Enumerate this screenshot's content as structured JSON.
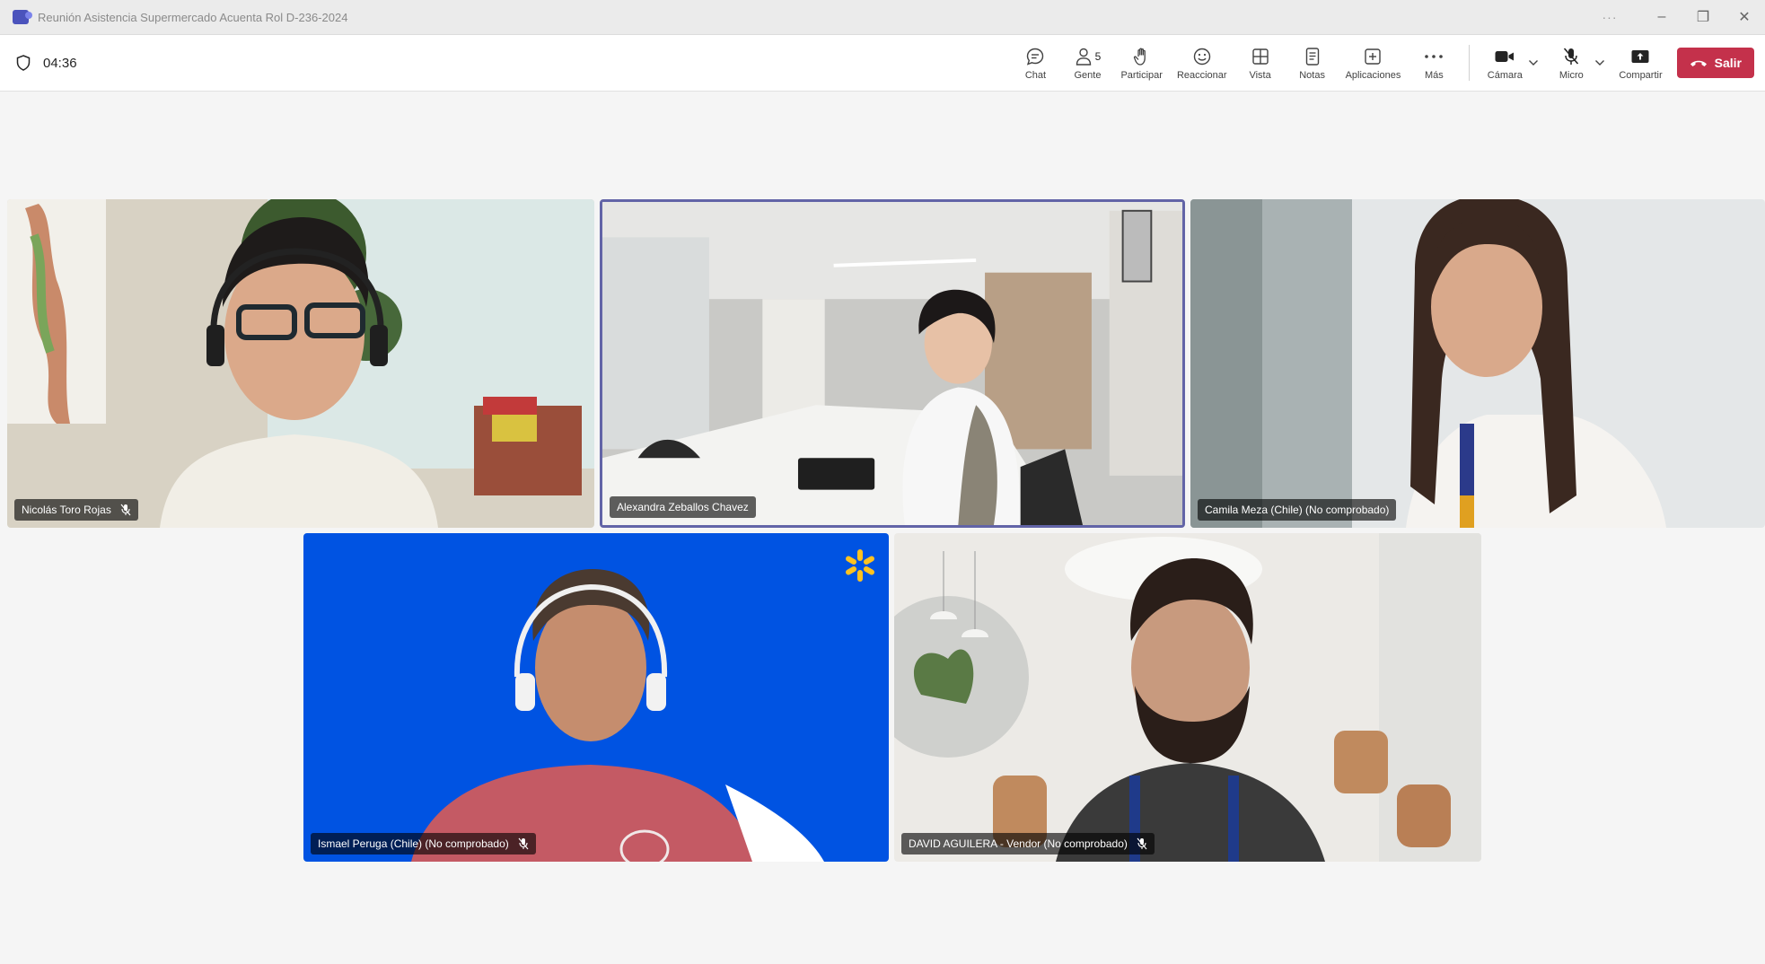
{
  "window": {
    "title": "Reunión Asistencia Supermercado Acuenta Rol D-236-2024",
    "more": "···",
    "minimize": "–",
    "restore": "❐",
    "close": "✕"
  },
  "meeting": {
    "timer": "04:36"
  },
  "toolbar": {
    "chat": "Chat",
    "people": "Gente",
    "people_count": "5",
    "raise_hand": "Participar",
    "react": "Reaccionar",
    "view": "Vista",
    "notes": "Notas",
    "apps": "Aplicaciones",
    "more": "Más",
    "camera": "Cámara",
    "mic": "Micro",
    "share": "Compartir",
    "leave": "Salir"
  },
  "colors": {
    "leave": "#c4314b",
    "active_border": "#6264a7",
    "teams_brand": "#4b53bc",
    "walmart_blue": "#0053e2",
    "walmart_spark": "#ffc220"
  },
  "participants": [
    {
      "name": "Nicolás Toro Rojas",
      "muted": true
    },
    {
      "name": "Alexandra Zeballos Chavez",
      "muted": false,
      "active": true
    },
    {
      "name": "Camila Meza (Chile) (No comprobado)",
      "muted": false
    },
    {
      "name": "Ismael Peruga (Chile) (No comprobado)",
      "muted": true
    },
    {
      "name": "DAVID AGUILERA - Vendor (No comprobado)",
      "muted": true
    }
  ]
}
